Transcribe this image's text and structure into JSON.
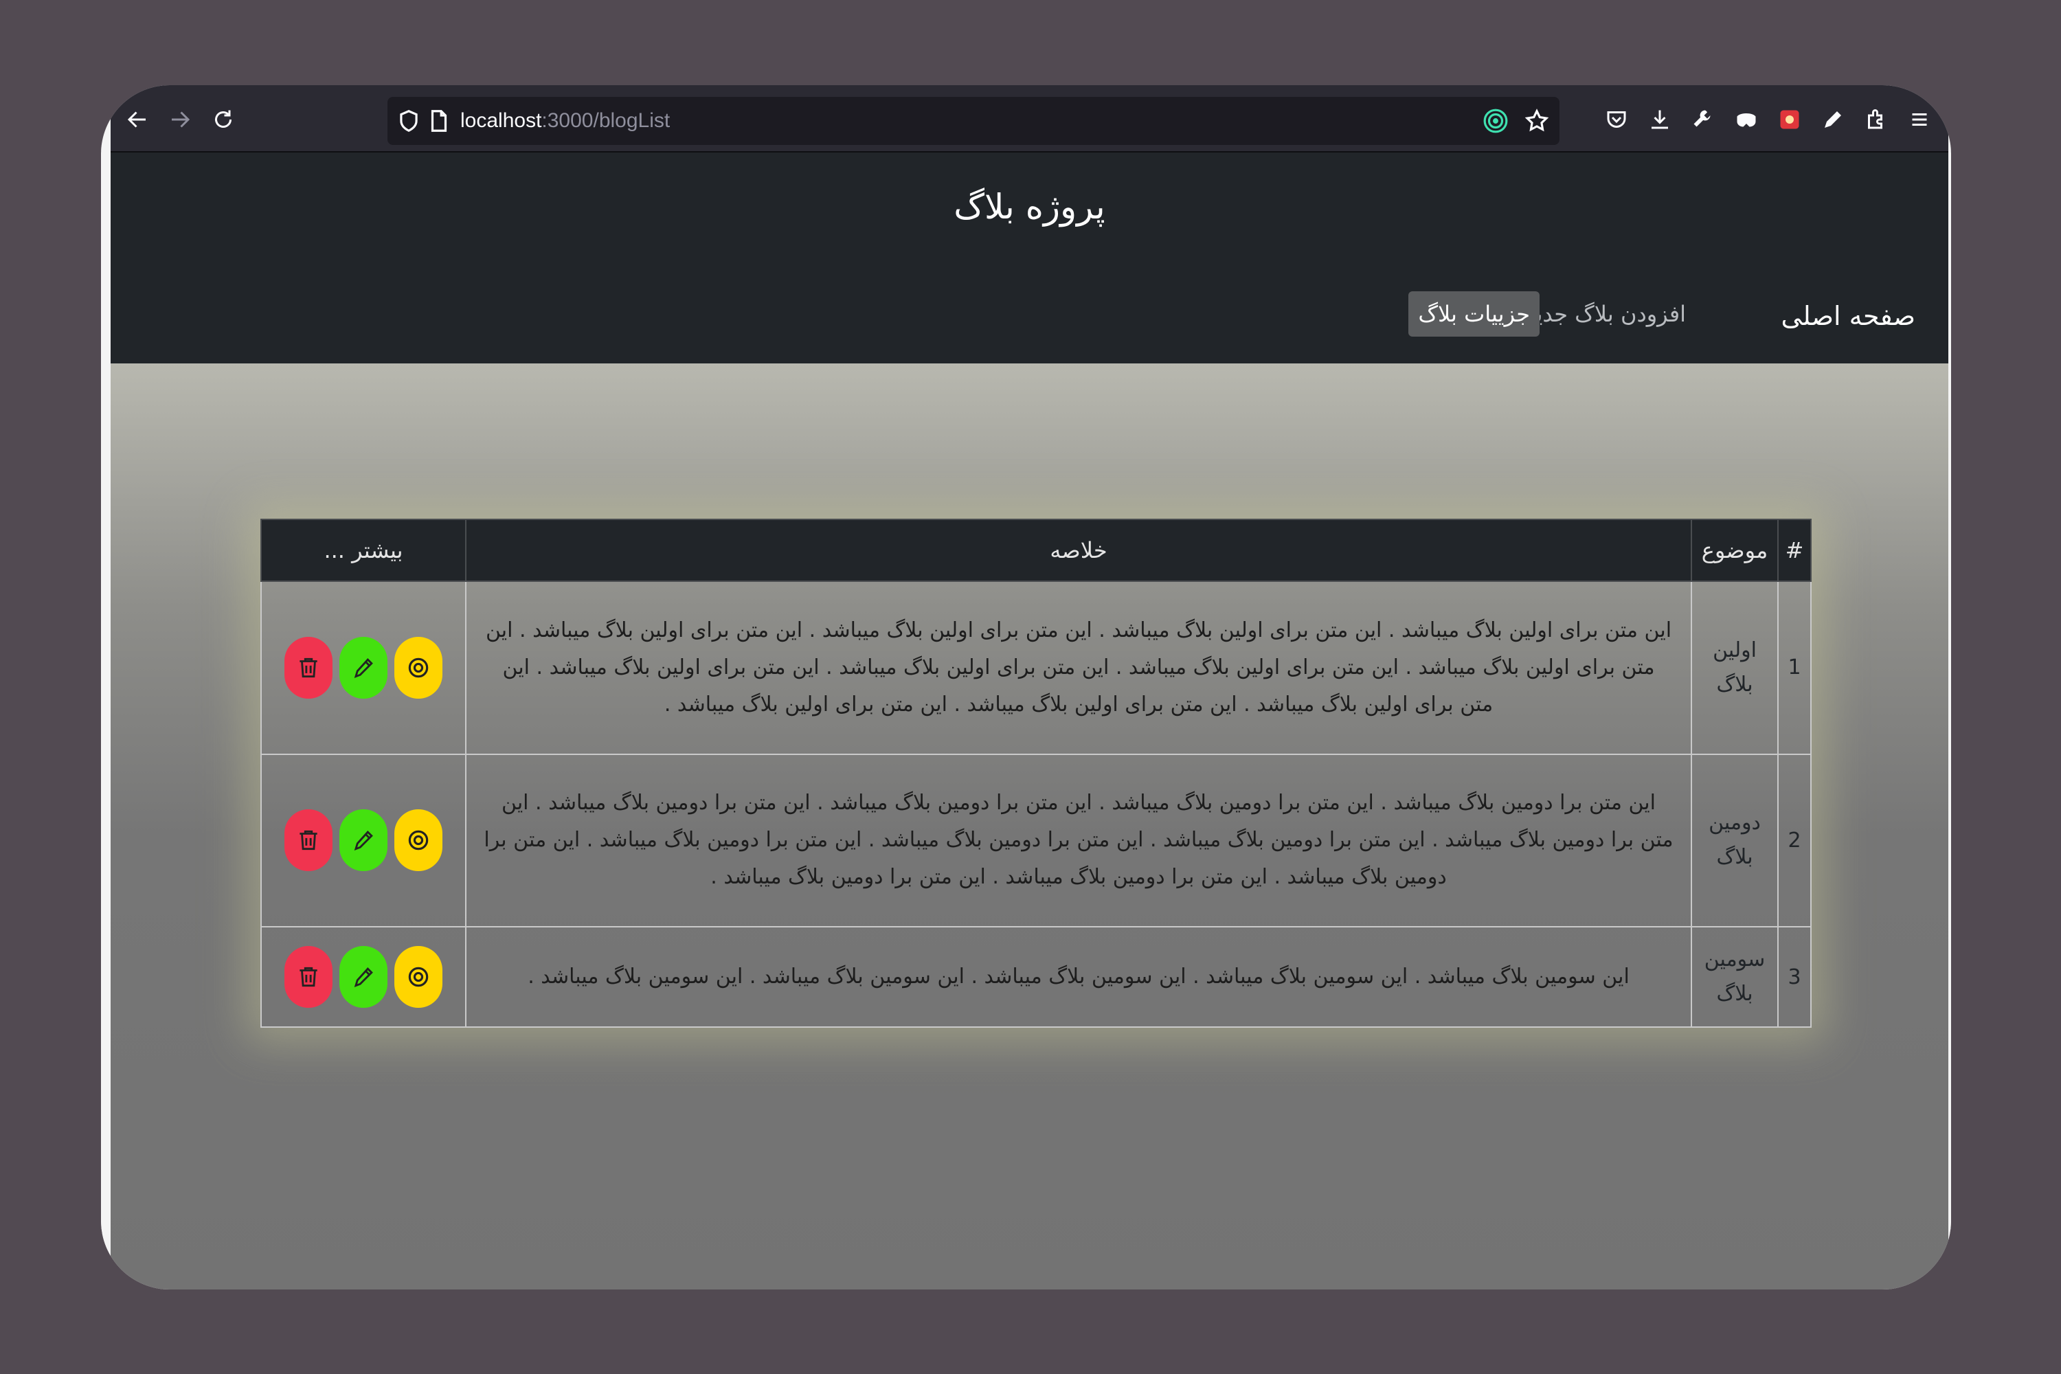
{
  "browser": {
    "url_host": "localhost",
    "url_rest": ":3000/blogList"
  },
  "site": {
    "title": "پروژه بلاگ",
    "nav": {
      "brand": "صفحه اصلی",
      "add_blog": "افزودن بلاگ جدید",
      "blog_details": "جزییات بلاگ"
    }
  },
  "table": {
    "headers": {
      "num": "#",
      "title": "موضوع",
      "summary": "خلاصه",
      "more": "بیشتر ..."
    },
    "rows": [
      {
        "num": "1",
        "title": "اولین بلاگ",
        "summary": "این متن برای اولین بلاگ میباشد . این متن برای اولین بلاگ میباشد . این متن برای اولین بلاگ میباشد . این متن برای اولین بلاگ میباشد . این متن برای اولین بلاگ میباشد . این متن برای اولین بلاگ میباشد . این متن برای اولین بلاگ میباشد . این متن برای اولین بلاگ میباشد . این متن برای اولین بلاگ میباشد . این متن برای اولین بلاگ میباشد . این متن برای اولین بلاگ میباشد ."
      },
      {
        "num": "2",
        "title": "دومین بلاگ",
        "summary": "این متن برا دومین بلاگ میباشد . این متن برا دومین بلاگ میباشد . این متن برا دومین بلاگ میباشد . این متن برا دومین بلاگ میباشد . این متن برا دومین بلاگ میباشد . این متن برا دومین بلاگ میباشد . این متن برا دومین بلاگ میباشد . این متن برا دومین بلاگ میباشد . این متن برا دومین بلاگ میباشد . این متن برا دومین بلاگ میباشد . این متن برا دومین بلاگ میباشد ."
      },
      {
        "num": "3",
        "title": "سومین بلاگ",
        "summary": "این سومین بلاگ میباشد . این سومین بلاگ میباشد . این سومین بلاگ میباشد . این سومین بلاگ میباشد . این سومین بلاگ میباشد ."
      }
    ]
  },
  "colors": {
    "view": "#ffd500",
    "edit": "#44e10f",
    "delete": "#f0344f",
    "header_bg": "#212529"
  }
}
